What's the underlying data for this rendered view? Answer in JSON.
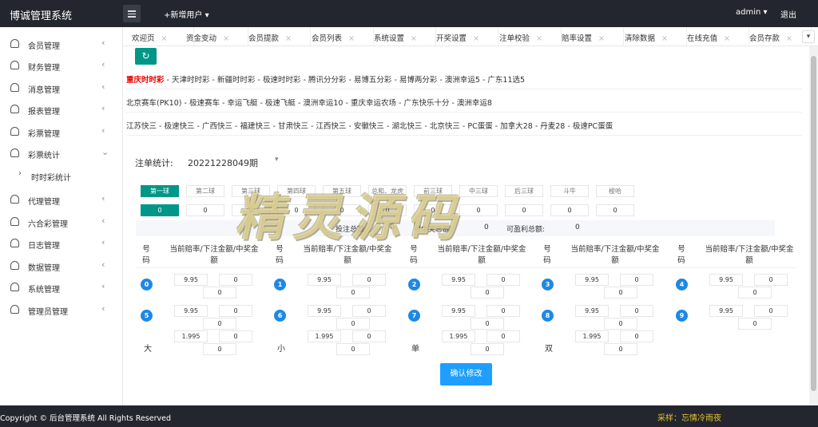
{
  "app": {
    "title": "博诚管理系统",
    "add_user": "+新增用户",
    "admin": "admin",
    "logout": "退出"
  },
  "sidebar": {
    "items": [
      {
        "label": "会员管理"
      },
      {
        "label": "财务管理"
      },
      {
        "label": "消息管理"
      },
      {
        "label": "报表管理"
      },
      {
        "label": "彩票管理"
      },
      {
        "label": "彩票统计"
      },
      {
        "label": "时时彩统计"
      },
      {
        "label": "代理管理"
      },
      {
        "label": "六合彩管理"
      },
      {
        "label": "日志管理"
      },
      {
        "label": "数据管理"
      },
      {
        "label": "系统管理"
      },
      {
        "label": "管理员管理"
      }
    ]
  },
  "tabs": [
    "欢迎页",
    "资金变动",
    "会员提款",
    "会员列表",
    "系统设置",
    "开奖设置",
    "注单校验",
    "赔率设置",
    "清除数据",
    "在线充值",
    "会员存款"
  ],
  "lottery_rows": [
    [
      "重庆时时彩",
      "天津时时彩",
      "新疆时时彩",
      "极速时时彩",
      "腾讯分分彩",
      "易博五分彩",
      "易博两分彩",
      "澳洲幸运5",
      "广东11选5"
    ],
    [
      "北京赛车(PK10)",
      "极速赛车",
      "幸运飞艇",
      "极速飞艇",
      "澳洲幸运10",
      "重庆幸运农场",
      "广东快乐十分",
      "澳洲幸运8"
    ],
    [
      "江苏快三",
      "极速快三",
      "广西快三",
      "福建快三",
      "甘肃快三",
      "江西快三",
      "安徽快三",
      "湖北快三",
      "北京快三",
      "PC蛋蛋",
      "加拿大28",
      "丹麦28",
      "极速PC蛋蛋"
    ]
  ],
  "stats": {
    "label": "注单统计:",
    "period": "20221228049期",
    "ball_tabs": [
      "第一球",
      "第二球",
      "第三球",
      "第四球",
      "第五球",
      "总和、龙虎",
      "前三球",
      "中三球",
      "后三球",
      "斗牛",
      "梭哈"
    ],
    "ball_values": [
      "0",
      "0",
      "0",
      "0",
      "0",
      "0",
      "0",
      "0",
      "0",
      "0",
      "0"
    ],
    "summary": {
      "total_label": "投注总额:",
      "total": "0",
      "win_label": "可中奖总额:",
      "win": "0",
      "profit_label": "可盈利总额:",
      "profit": "0"
    },
    "col_header_num": "号码",
    "col_header_data": "当前赔率/下注金额/中奖金额",
    "rows": [
      [
        {
          "n": "0",
          "odds": "9.95",
          "bet": "0",
          "win": "0"
        },
        {
          "n": "1",
          "odds": "9.95",
          "bet": "0",
          "win": "0"
        },
        {
          "n": "2",
          "odds": "9.95",
          "bet": "0",
          "win": "0"
        },
        {
          "n": "3",
          "odds": "9.95",
          "bet": "0",
          "win": "0"
        },
        {
          "n": "4",
          "odds": "9.95",
          "bet": "0",
          "win": "0"
        }
      ],
      [
        {
          "n": "5",
          "odds": "9.95",
          "bet": "0",
          "win": "0"
        },
        {
          "n": "6",
          "odds": "9.95",
          "bet": "0",
          "win": "0"
        },
        {
          "n": "7",
          "odds": "9.95",
          "bet": "0",
          "win": "0"
        },
        {
          "n": "8",
          "odds": "9.95",
          "bet": "0",
          "win": "0"
        },
        {
          "n": "9",
          "odds": "9.95",
          "bet": "0",
          "win": "0"
        }
      ],
      [
        {
          "n": "大",
          "odds": "1.995",
          "bet": "0",
          "win": "0"
        },
        {
          "n": "小",
          "odds": "1.995",
          "bet": "0",
          "win": "0"
        },
        {
          "n": "单",
          "odds": "1.995",
          "bet": "0",
          "win": "0"
        },
        {
          "n": "双",
          "odds": "1.995",
          "bet": "0",
          "win": "0"
        }
      ]
    ],
    "confirm": "确认修改"
  },
  "watermark": "精灵源码",
  "footer": {
    "copyright": "Copyright © 后台管理系统 All Rights Reserved",
    "credit": "采样：忘情冷雨夜"
  },
  "colors": {
    "topbar": "#23262e",
    "accent": "#009688",
    "ball": "#1e88e5",
    "button": "#1e9fff",
    "active_lottery": "#ee0000"
  }
}
